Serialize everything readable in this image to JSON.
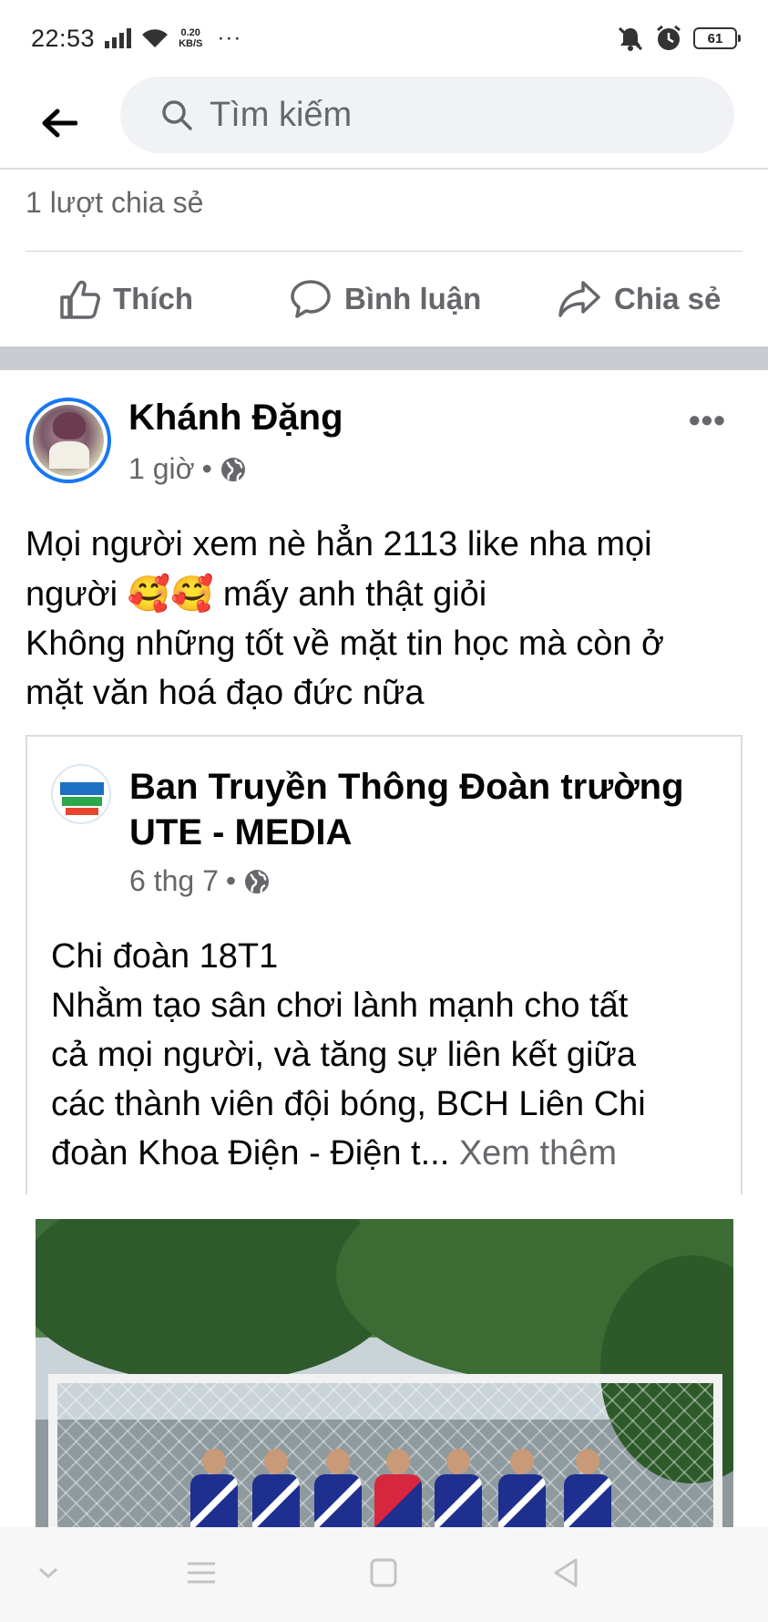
{
  "status_bar": {
    "time": "22:53",
    "speed_value": "0.20",
    "speed_unit": "KB/S",
    "more": "···",
    "battery": "61"
  },
  "search": {
    "placeholder": "Tìm kiếm"
  },
  "previous_post": {
    "share_count": "1 lượt chia sẻ",
    "actions": {
      "like": "Thích",
      "comment": "Bình luận",
      "share": "Chia sẻ"
    }
  },
  "post": {
    "author": "Khánh Đặng",
    "time": "1 giờ",
    "separator": "•",
    "more": "•••",
    "text_line1": "Mọi người xem nè hẳn 2113 like nha mọi",
    "text_line2_a": "người",
    "emoji": "🥰🥰",
    "text_line2_b": "mấy anh thật giỏi",
    "text_line3": "Không những tốt về mặt tin học mà còn ở",
    "text_line4": "mặt văn hoá đạo đức nữa"
  },
  "shared_post": {
    "page_name_line1": "Ban Truyền Thông Đoàn trường",
    "page_name_line2": "UTE - MEDIA",
    "time": "6 thg 7",
    "separator": "•",
    "text_line1": "Chi đoàn 18T1",
    "text_line2": "Nhằm tạo sân chơi lành mạnh cho tất",
    "text_line3": "cả mọi người, và tăng sự liên kết giữa",
    "text_line4": "các thành viên đội bóng, BCH Liên Chi",
    "text_line5": "đoàn Khoa Điện - Điện t...",
    "see_more": "Xem thêm"
  },
  "colors": {
    "accent": "#1877f2",
    "secondary_text": "#65676b",
    "separator": "#c9ccd1"
  },
  "icons": {
    "back": "arrow-left-icon",
    "search": "search-icon",
    "like": "thumbs-up-icon",
    "comment": "comment-icon",
    "share": "share-icon",
    "privacy": "globe-icon"
  }
}
